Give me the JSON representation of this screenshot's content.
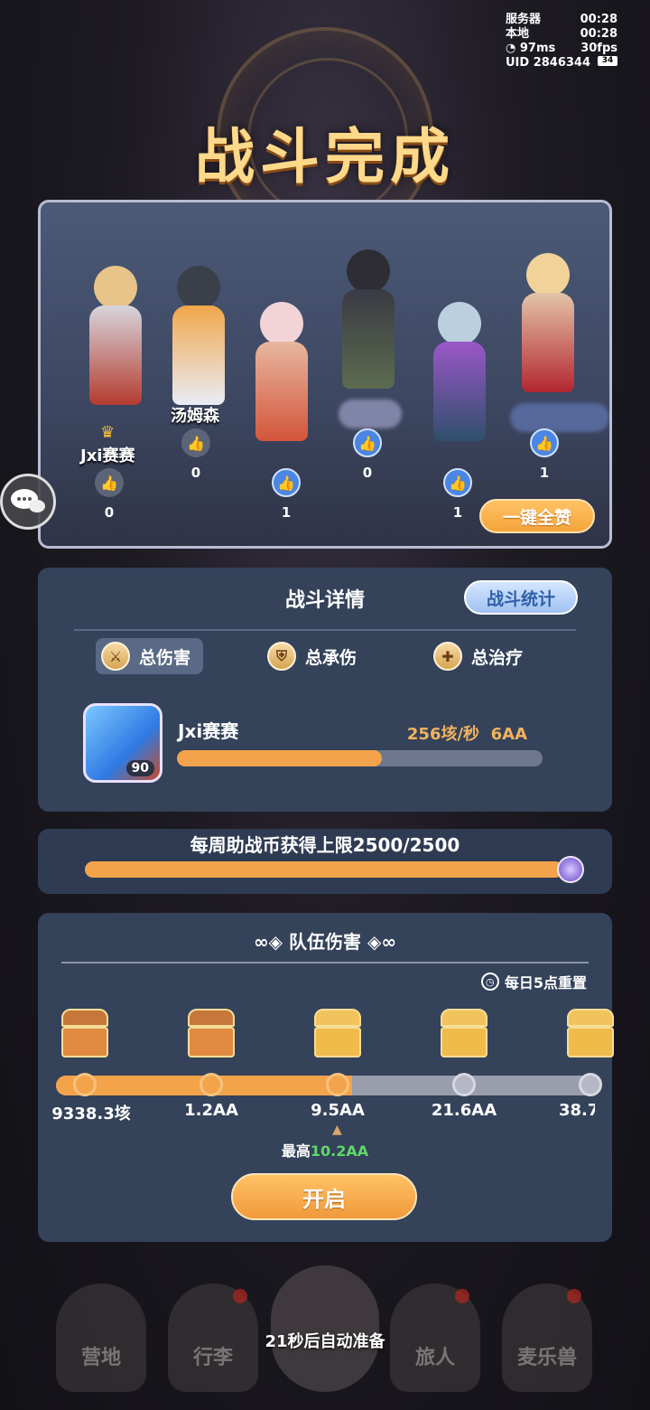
{
  "status": {
    "server_label": "服务器",
    "server_time": "00:28",
    "local_label": "本地",
    "local_time": "00:28",
    "ping": "97ms",
    "fps": "30fps",
    "uid": "UID 2846344",
    "battery": "34"
  },
  "title": "战斗完成",
  "team": {
    "members": [
      {
        "name": "Jxi赛赛",
        "likes": "0",
        "liked": false
      },
      {
        "name": "汤姆森",
        "likes": "0",
        "liked": false
      },
      {
        "name": "",
        "likes": "1",
        "liked": true
      },
      {
        "name": "",
        "likes": "0",
        "liked": true
      },
      {
        "name": "",
        "likes": "1",
        "liked": true
      },
      {
        "name": "",
        "likes": "1",
        "liked": true
      }
    ],
    "like_all_label": "一键全赞"
  },
  "detail": {
    "header": "战斗详情",
    "stats_button": "战斗统计",
    "tabs": [
      {
        "label": "总伤害",
        "icon": "sword-icon",
        "active": true
      },
      {
        "label": "总承伤",
        "icon": "shield-icon",
        "active": false
      },
      {
        "label": "总治疗",
        "icon": "heal-cross-icon",
        "active": false
      }
    ],
    "player": {
      "name": "Jxi赛赛",
      "level": "90",
      "dps": "256垓/秒",
      "total": "6AA",
      "bar_fraction": 0.56
    }
  },
  "weekly": {
    "text": "每周助战币获得上限2500/2500",
    "fraction": 1.0
  },
  "team_damage": {
    "header": "队伍伤害",
    "reset_text": "每日5点重置",
    "milestones": [
      "9338.3垓",
      "1.2AA",
      "9.5AA",
      "21.6AA",
      "38.7"
    ],
    "opened": [
      true,
      true,
      false,
      false,
      false
    ],
    "progress_fraction": 0.55,
    "max_label": "最高",
    "max_value": "10.2AA",
    "open_button": "开启"
  },
  "nav": {
    "items": [
      "营地",
      "行李",
      "",
      "旅人",
      "麦乐兽"
    ],
    "auto_ready": "21秒后自动准备"
  },
  "colors": {
    "accent_orange": "#f3a44b",
    "panel": "#34425a",
    "title_gold": "#ffd98a",
    "like_blue": "#4b86e4",
    "highlight_green": "#5fd86a"
  }
}
